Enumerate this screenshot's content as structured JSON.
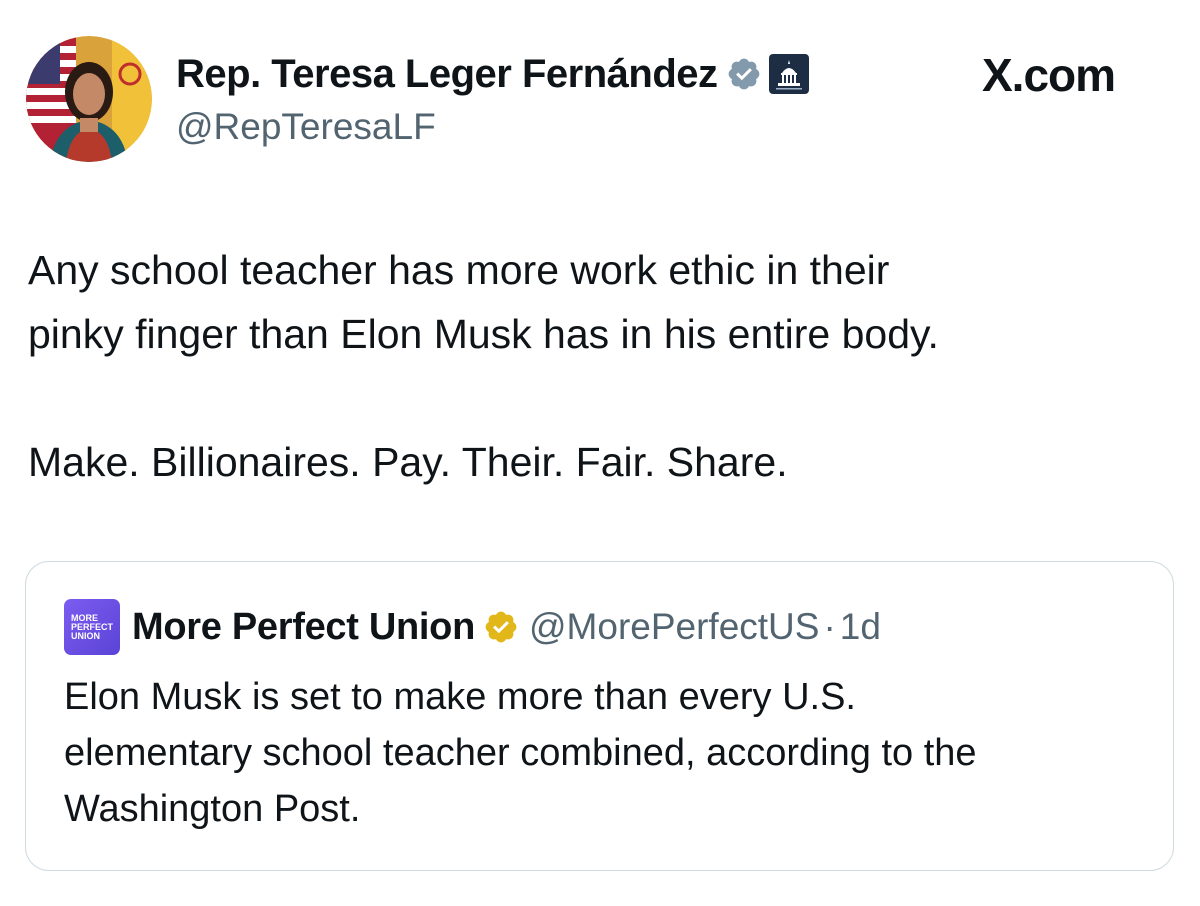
{
  "tweet": {
    "author_name": "Rep. Teresa Leger Fernández",
    "author_handle": "@RepTeresaLF",
    "site_label": "X.com",
    "text_lines": [
      "Any school teacher has more work ethic in their",
      "pinky finger than Elon Musk has in his entire body."
    ],
    "text_line_3": "Make. Billionaires. Pay. Their. Fair. Share.",
    "icons": {
      "avatar": "avatar-photo",
      "verified": "verified-gray-badge-icon",
      "affiliation": "capitol-building-icon"
    }
  },
  "quote": {
    "author_name": "More Perfect Union",
    "author_handle": "@MorePerfectUS",
    "separator": "·",
    "time": "1d",
    "logo_text": [
      "MORE",
      "PERFECT",
      "UNION"
    ],
    "text_lines": [
      "Elon Musk is set to make more than every U.S.",
      "elementary school teacher combined, according to the",
      "Washington Post."
    ],
    "icons": {
      "verified": "verified-gold-badge-icon"
    }
  },
  "colors": {
    "text_primary": "#0f1419",
    "text_secondary": "#536471",
    "verified_gray": "#829aab",
    "verified_gold": "#e2b719",
    "mpu_purple": "#6a4fe3",
    "card_border": "#cfd9de"
  }
}
